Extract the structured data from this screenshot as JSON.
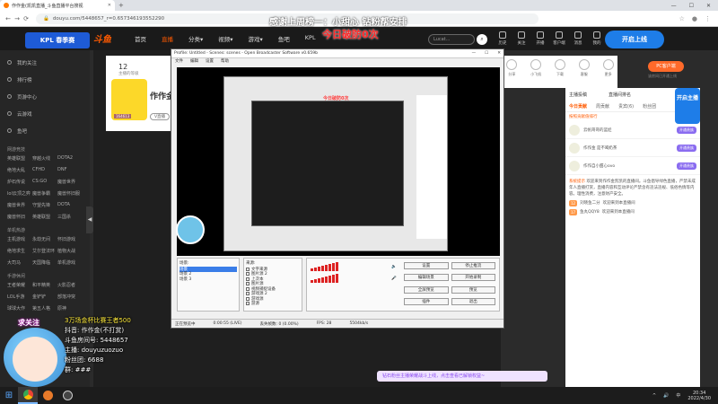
{
  "browser": {
    "tab_title": "作作金(凯凯直播_斗鱼直播平台搜视",
    "url": "douyu.com/5448657_r=0.657346193552290",
    "nav_back": "←",
    "nav_forward": "→",
    "nav_reload": "⟳"
  },
  "site": {
    "kpl_label": "KPL 春季赛",
    "logo": "斗鱼",
    "nav": [
      "首页",
      "直播",
      "分类▾",
      "视频▾",
      "游戏▾",
      "鱼吧",
      "KPL"
    ],
    "search_placeholder": "Lucat...",
    "header_icons": [
      "历史",
      "关注",
      "开播",
      "客户端",
      "消息",
      "我的"
    ],
    "kaiyue": "开启上线",
    "banner_top": "感谢上周榜一：小甜心   钻粉帮安排",
    "banner_red": "今日破防0次"
  },
  "sidebar": {
    "items": [
      "我的关注",
      "排行榜",
      "页游中心",
      "云游戏",
      "鱼吧"
    ],
    "section1": "网游竞技",
    "section1_grid": [
      "英雄联盟",
      "穿越火线",
      "DOTA2",
      "绝地大乱",
      "CFHD",
      "DNF",
      "炉石传说",
      "CS:GO",
      "魔兽世界",
      "lol云顶之弈",
      "魔兽争霸",
      "魔兽怀旧服",
      "魔兽世界",
      "守望先锋",
      "DOTA",
      "魔兽怀旧",
      "英雄联盟",
      "三国杀"
    ],
    "section2": "单机热游",
    "section2_grid": [
      "主机游戏",
      "永劫无间",
      "怀旧游戏",
      "绝地求生",
      "艾尔登法环",
      "植物大战",
      "大司马",
      "天国降临",
      "单机游戏"
    ],
    "section3": "手游休闲",
    "section3_grid": [
      "王者荣耀",
      "和平精英",
      "火影忍者",
      "LOL手游",
      "金铲铲",
      "部落冲突",
      "球球大作",
      "第五人格",
      "原神"
    ],
    "collapse": "◀"
  },
  "room": {
    "followers": "12",
    "followers_label": "主播的等级",
    "streamer_name": "作作金",
    "v_button": "V直播",
    "icons": [
      "分享",
      "小飞机",
      "下载",
      "客服",
      "更多"
    ],
    "pc_button": "PC客户端",
    "notice": "该房间已开通上线",
    "badge": "164613"
  },
  "right_panel": {
    "title": "主播投稿",
    "live_rank_label": "直播间排名",
    "tabs": [
      "今日贡献",
      "周贡献",
      "贵宾(6)",
      "粉丝团"
    ],
    "desc": "按照贡献值排行",
    "ranks": [
      {
        "name": "云帆哥哥的蓝娃",
        "tag": "开通贵族"
      },
      {
        "name": "作作金 是不喝奶茶",
        "tag": "开通贵族"
      },
      {
        "name": "作作自小甜心ovo",
        "tag": "开通贵族"
      }
    ],
    "system_tag": "系统提示",
    "system_text": "欢迎来到作作金凯凯的直播间。斗鱼倡导绿色直播，严禁未成年人直播打赏，直播内容和互动评论严禁含有违法违规、低俗色情等内容。理性消费，注意财产安全。",
    "chat_lines": [
      {
        "lv": "12",
        "user": "刘晓鱼二分",
        "text": "欢迎来到本直播间"
      },
      {
        "lv": "17",
        "user": "鱼丸QQY8",
        "text": "欢迎来到本直播间"
      }
    ],
    "side_promo": "开启主播"
  },
  "obs": {
    "title": "Profile: Untitled - Scenes: scenes - Open Broadcaster Software v0.659b",
    "menu": [
      "文件",
      "编辑",
      "设置",
      "帮助"
    ],
    "inner_red": "今日破防0次",
    "scenes_label": "场景:",
    "scenes": [
      "场景",
      "场景 2",
      "场景 3"
    ],
    "sources_label": "来源:",
    "sources": [
      "文字来源",
      "图片源 2",
      "上次本",
      "图片源",
      "视频捕捉设备",
      "游戏源 2",
      "游戏源",
      "游源"
    ],
    "buttons": [
      "设置",
      "停止推流",
      "编辑场景",
      "开始录制",
      "全屏预览",
      "预览",
      "插件",
      "退出"
    ],
    "status_left": "正在预览中",
    "status_time": "0:00:55 (LIVE)",
    "status_dropped": "丢失帧数: 0 (0.00%)",
    "status_fps": "FPS: 28",
    "status_kbps": "5504kb/s"
  },
  "overlay": {
    "qiuguanzhu": "求关注",
    "lines": [
      "3万场金杯比赛王者500",
      "抖音: 作作金(不打赏)",
      "斗鱼房间号: 5448657",
      "主播: douyuzuozuo",
      "粉丝团: 6688",
      "群: ###"
    ]
  },
  "footer_banner": "钻石粉丝主播荣耀战斗上线，点击查看已解锁权益~",
  "taskbar": {
    "time": "20:34",
    "date": "2022/4/30",
    "tray": [
      "^",
      "🔊",
      "中"
    ]
  }
}
